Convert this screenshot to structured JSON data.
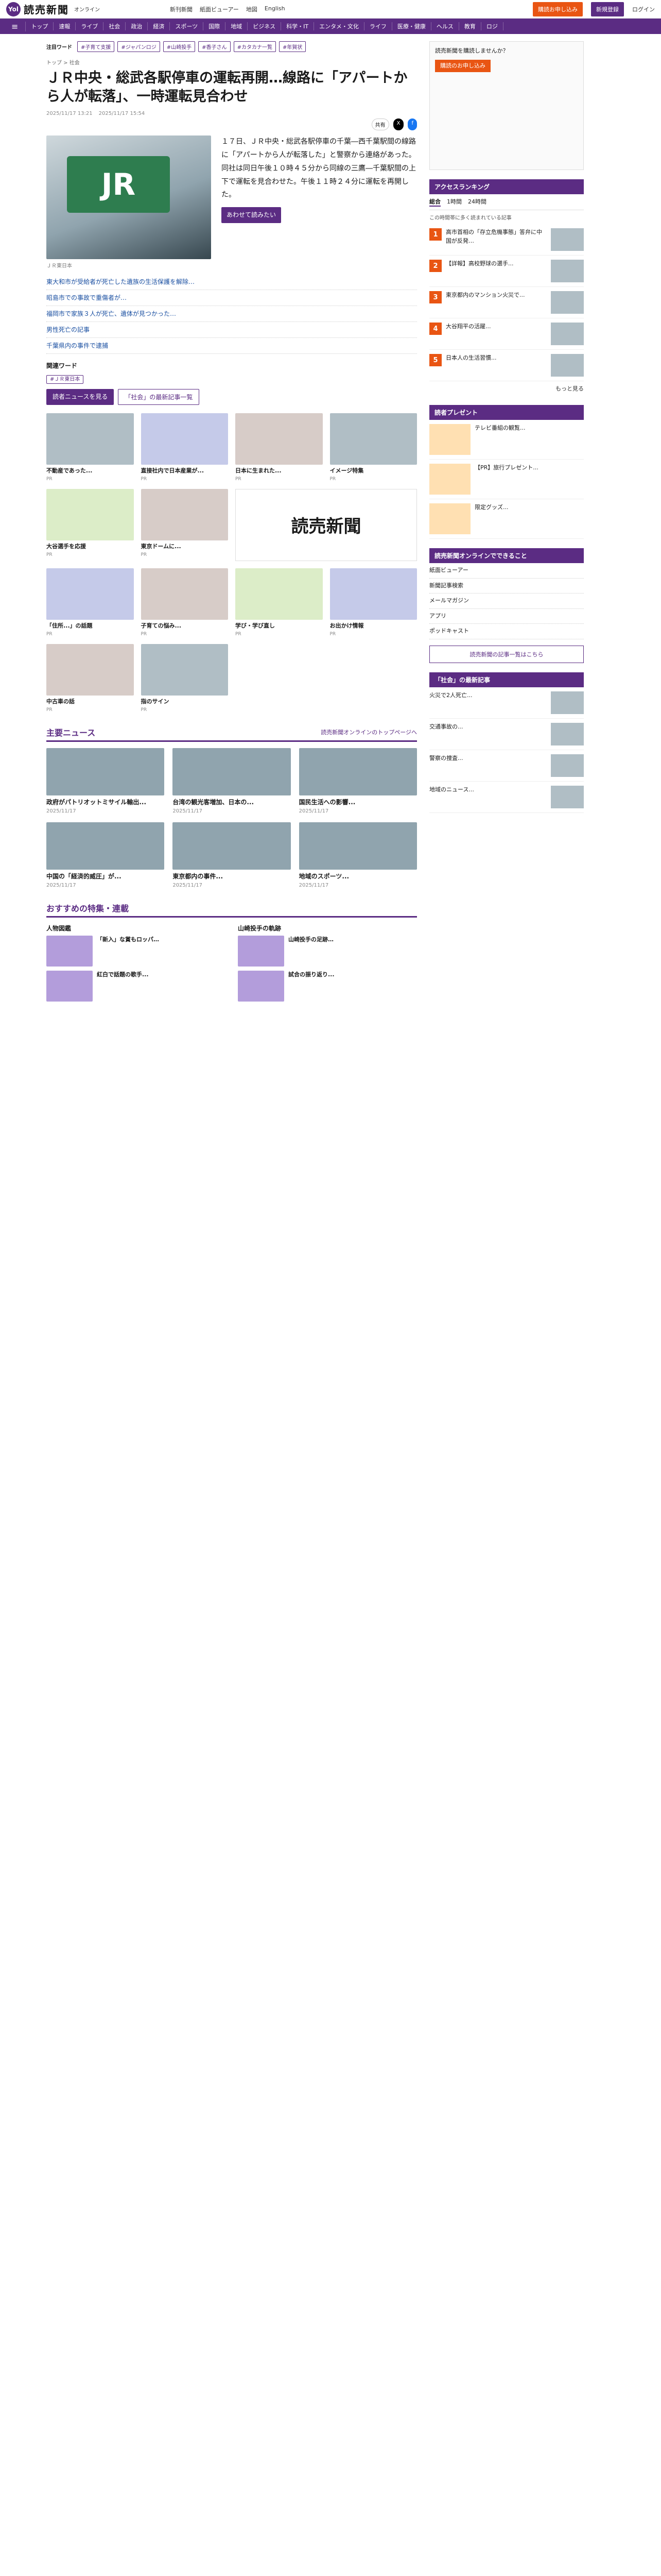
{
  "header": {
    "logo_mark": "Yol",
    "logo_text": "読売新聞",
    "logo_sub": "オンライン",
    "nav": [
      "新刊新聞",
      "紙面ビューアー",
      "地図",
      "English"
    ],
    "subscribe": "購読お申し込み",
    "register": "新規登録",
    "login": "ログイン"
  },
  "categories": [
    "≡",
    "トップ",
    "速報",
    "ライブ",
    "社会",
    "政治",
    "経済",
    "スポーツ",
    "国際",
    "地域",
    "ビジネス",
    "科学・IT",
    "エンタメ・文化",
    "ライフ",
    "医療・健康",
    "ヘルス",
    "教育",
    "ロジ"
  ],
  "trend": {
    "label": "注目ワード",
    "chips": [
      "#子育て支援",
      "#ジャパンロジ",
      "#山崎投手",
      "#香子さん",
      "#カタカナ一覧",
      "#年賀状"
    ]
  },
  "breadcrumb": "トップ > 社会",
  "article": {
    "headline": "ＪＲ中央・総武各駅停車の運転再開…線路に「アパートから人が転落」、一時運転見合わせ",
    "date": "2025/11/17 13:21",
    "updated": "2025/11/17 15:54",
    "caption": "ＪＲ東日本",
    "body": "１７日、ＪＲ中央・総武各駅停車の千葉―西千葉駅間の線路に「アパートから人が転落した」と警察から連絡があった。同社は同日午後１０時４５分から同線の三鷹―千葉駅間の上下で運転を見合わせた。午後１１時２４分に運転を再開した。",
    "more_label": "あわせて読みたい",
    "related": [
      "東大和市が受給者が死亡した遺族の生活保護を解除…",
      "昭島市での事故で重傷者が…",
      "福岡市で家族３人が死亡、遺体が見つかった…",
      "男性死亡の記事",
      "千葉県内の事件で逮捕"
    ],
    "share": [
      "共有",
      "X",
      "f"
    ]
  },
  "keywords": {
    "title": "関連ワード",
    "items": [
      "#ＪＲ東日本"
    ]
  },
  "actions": {
    "follow": "読者ニュースを見る",
    "social": "「社会」の最新記事一覧"
  },
  "ads": [
    {
      "title": "不動産であった...",
      "src": "PR"
    },
    {
      "title": "直接社内で日本産業が...",
      "src": "PR"
    },
    {
      "title": "日本に生まれた...",
      "src": "PR"
    },
    {
      "title": "イメージ特集",
      "src": "PR"
    },
    {
      "title": "大谷選手を応援",
      "src": "PR"
    },
    {
      "title": "東京ドームに...",
      "src": "PR"
    },
    {
      "title": "「住所...」の話題",
      "src": "PR"
    },
    {
      "title": "子育ての悩み...",
      "src": "PR"
    },
    {
      "title": "学び・学び直し",
      "src": "PR"
    },
    {
      "title": "お出かけ情報",
      "src": "PR"
    },
    {
      "title": "中古車の話",
      "src": "PR"
    },
    {
      "title": "指のサイン",
      "src": "PR"
    }
  ],
  "ad_logo": "読売新聞",
  "main_news": {
    "title": "主要ニュース",
    "link": "読売新聞オンラインのトップページへ",
    "items": [
      {
        "title": "政府がパトリオットミサイル輸出...",
        "date": "2025/11/17"
      },
      {
        "title": "台湾の観光客増加、日本の...",
        "date": "2025/11/17"
      },
      {
        "title": "国民生活への影響...",
        "date": "2025/11/17"
      },
      {
        "title": "中国の「経済的威圧」が...",
        "date": "2025/11/17"
      },
      {
        "title": "東京都内の事件...",
        "date": "2025/11/17"
      },
      {
        "title": "地域のスポーツ...",
        "date": "2025/11/17"
      }
    ]
  },
  "specials": {
    "title": "おすすめの特集・連載",
    "groups": [
      {
        "name": "人物図鑑",
        "items": [
          "「新入」な賞もロッパ…",
          "紅白で話題の歌手..."
        ]
      },
      {
        "name": "山崎投手の軌跡",
        "items": [
          "山崎投手の足跡…",
          "試合の振り返り..."
        ]
      }
    ]
  },
  "sidebar": {
    "ad_text": "読売新聞を購読しませんか？",
    "ad_button": "購読のお申し込み",
    "ranking_title": "アクセスランキング",
    "tabs": [
      "総合",
      "1時間",
      "24時間"
    ],
    "note": "この時間帯に多く読まれている記事",
    "ranking": [
      {
        "num": "1",
        "title": "高市首相の「存立危機事態」答弁に中国が反発…"
      },
      {
        "num": "2",
        "title": "【詳報】高校野球の選手..."
      },
      {
        "num": "3",
        "title": "東京都内のマンション火災で..."
      },
      {
        "num": "4",
        "title": "大谷翔平の活躍..."
      },
      {
        "num": "5",
        "title": "日本人の生活習慣..."
      }
    ],
    "more": "もっと見る",
    "gift_title": "読者プレゼント",
    "gifts": [
      {
        "title": "テレビ番組の観覧..."
      },
      {
        "title": "【PR】旅行プレゼント..."
      },
      {
        "title": "限定グッズ..."
      }
    ],
    "yomiuri_title": "読売新聞オンラインでできること",
    "yomiuri_items": [
      "紙面ビューアー",
      "新聞記事検索",
      "メールマガジン",
      "アプリ",
      "ポッドキャスト"
    ],
    "side_button": "読売新聞の記事一覧はこちら",
    "latest_title": "「社会」の最新記事",
    "latest": [
      "火災で2人死亡...",
      "交通事故の...",
      "警察の捜査...",
      "地域のニュース..."
    ]
  }
}
